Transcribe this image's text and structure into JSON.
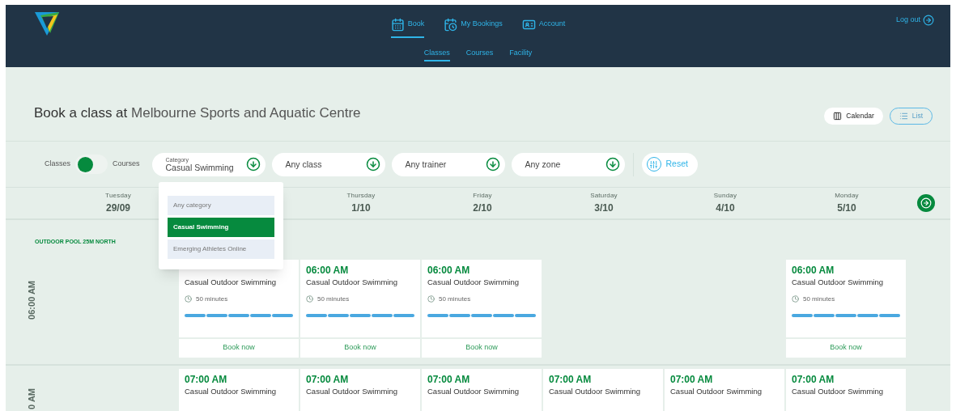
{
  "header": {
    "nav": [
      {
        "label": "Book",
        "selected": true
      },
      {
        "label": "My Bookings",
        "selected": false
      },
      {
        "label": "Account",
        "selected": false
      }
    ],
    "subnav": [
      {
        "label": "Classes",
        "selected": true
      },
      {
        "label": "Courses",
        "selected": false
      },
      {
        "label": "Facility",
        "selected": false
      }
    ],
    "logout": "Log out"
  },
  "title": {
    "prefix": "Book a class at",
    "venue": "Melbourne Sports and Aquatic Centre"
  },
  "views": [
    {
      "label": "Calendar",
      "selected": true
    },
    {
      "label": "List",
      "selected": false
    }
  ],
  "filters": {
    "mode": {
      "left": "Classes",
      "right": "Courses",
      "right_selected": false
    },
    "dropdowns": [
      {
        "label": "Category",
        "value": "Casual Swimming"
      },
      {
        "value": "Any class"
      },
      {
        "value": "Any trainer"
      },
      {
        "value": "Any zone"
      }
    ],
    "reset": "Reset"
  },
  "category_menu": [
    {
      "label": "Any category",
      "selected": false
    },
    {
      "label": "Casual Swimming",
      "selected": true
    },
    {
      "label": "Emerging Athletes Online",
      "selected": false
    }
  ],
  "days": [
    {
      "weekday": "Tuesday",
      "date": "29/09"
    },
    {
      "weekday": "Thursday",
      "date": "1/10"
    },
    {
      "weekday": "Friday",
      "date": "2/10"
    },
    {
      "weekday": "Saturday",
      "date": "3/10"
    },
    {
      "weekday": "Sunday",
      "date": "4/10"
    },
    {
      "weekday": "Monday",
      "date": "5/10"
    }
  ],
  "rows": [
    {
      "section": "OUTDOOR POOL 25M NORTH",
      "time": "06:00 AM",
      "slots": [
        {
          "kind": "empty"
        },
        {
          "kind": "class",
          "name": "Casual Outdoor Swimming",
          "duration": "50 minutes",
          "action": "Book now"
        },
        {
          "kind": "class",
          "time": "06:00 AM",
          "name": "Casual Outdoor Swimming",
          "duration": "50 minutes",
          "action": "Book now"
        },
        {
          "kind": "class",
          "time": "06:00 AM",
          "name": "Casual Outdoor Swimming",
          "duration": "50 minutes",
          "action": "Book now"
        },
        {
          "kind": "empty"
        },
        {
          "kind": "empty"
        },
        {
          "kind": "class",
          "time": "06:00 AM",
          "name": "Casual Outdoor Swimming",
          "duration": "50 minutes",
          "action": "Book now"
        }
      ]
    },
    {
      "time": "0 AM",
      "slots": [
        {
          "kind": "empty"
        },
        {
          "kind": "class",
          "time": "07:00 AM",
          "name": "Casual Outdoor Swimming"
        },
        {
          "kind": "class",
          "time": "07:00 AM",
          "name": "Casual Outdoor Swimming"
        },
        {
          "kind": "class",
          "time": "07:00 AM",
          "name": "Casual Outdoor Swimming"
        },
        {
          "kind": "class",
          "time": "07:00 AM",
          "name": "Casual Outdoor Swimming"
        },
        {
          "kind": "class",
          "time": "07:00 AM",
          "name": "Casual Outdoor Swimming"
        },
        {
          "kind": "class",
          "time": "07:00 AM",
          "name": "Casual Outdoor Swimming"
        }
      ]
    }
  ]
}
